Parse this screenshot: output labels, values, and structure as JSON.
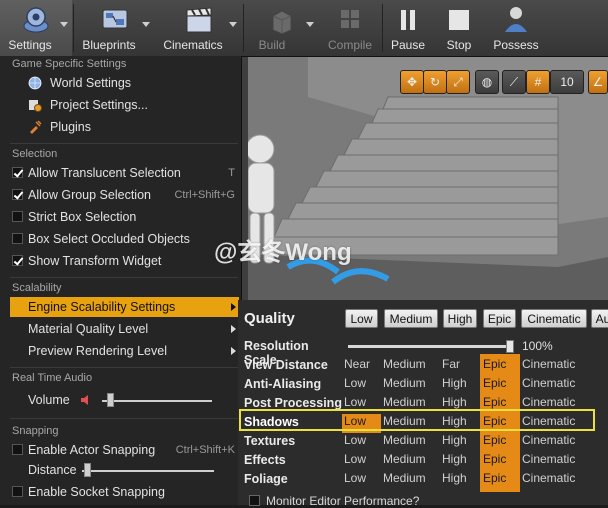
{
  "toolbar": {
    "settings": "Settings",
    "blueprints": "Blueprints",
    "cinematics": "Cinematics",
    "build": "Build",
    "compile": "Compile",
    "pause": "Pause",
    "stop": "Stop",
    "possess": "Possess"
  },
  "viewport": {
    "grid_snap_value": "10"
  },
  "menu": {
    "game_specific_header": "Game Specific Settings",
    "world_settings": "World Settings",
    "project_settings": "Project Settings...",
    "plugins": "Plugins",
    "selection_header": "Selection",
    "allow_translucent": "Allow Translucent Selection",
    "allow_translucent_shortcut": "T",
    "allow_group": "Allow Group Selection",
    "allow_group_shortcut": "Ctrl+Shift+G",
    "strict_box": "Strict Box Selection",
    "box_occluded": "Box Select Occluded Objects",
    "show_transform": "Show Transform Widget",
    "scalability_header": "Scalability",
    "engine_scalability": "Engine Scalability Settings",
    "material_quality": "Material Quality Level",
    "preview_rendering": "Preview Rendering Level",
    "realtime_audio_header": "Real Time Audio",
    "volume": "Volume",
    "snapping_header": "Snapping",
    "enable_actor_snapping": "Enable Actor Snapping",
    "enable_actor_snapping_shortcut": "Ctrl+Shift+K",
    "distance": "Distance",
    "enable_socket_snapping": "Enable Socket Snapping"
  },
  "checkboxes": {
    "allow_translucent": true,
    "allow_group": true,
    "strict_box": false,
    "box_occluded": false,
    "show_transform": true,
    "enable_actor_snapping": false,
    "enable_socket_snapping": false
  },
  "quality": {
    "title": "Quality",
    "presets": [
      "Low",
      "Medium",
      "High",
      "Epic",
      "Cinematic",
      "Au"
    ],
    "resolution_label": "Resolution Scale",
    "resolution_value": "100%",
    "rows": [
      {
        "label": "View Distance",
        "options": [
          "Near",
          "Medium",
          "Far",
          "Epic",
          "Cinematic"
        ],
        "selected": 3
      },
      {
        "label": "Anti-Aliasing",
        "options": [
          "Low",
          "Medium",
          "High",
          "Epic",
          "Cinematic"
        ],
        "selected": 3
      },
      {
        "label": "Post Processing",
        "options": [
          "Low",
          "Medium",
          "High",
          "Epic",
          "Cinematic"
        ],
        "selected": 3
      },
      {
        "label": "Shadows",
        "options": [
          "Low",
          "Medium",
          "High",
          "Epic",
          "Cinematic"
        ],
        "selected": 0
      },
      {
        "label": "Textures",
        "options": [
          "Low",
          "Medium",
          "High",
          "Epic",
          "Cinematic"
        ],
        "selected": 3
      },
      {
        "label": "Effects",
        "options": [
          "Low",
          "Medium",
          "High",
          "Epic",
          "Cinematic"
        ],
        "selected": 3
      },
      {
        "label": "Foliage",
        "options": [
          "Low",
          "Medium",
          "High",
          "Epic",
          "Cinematic"
        ],
        "selected": 3
      }
    ],
    "monitor_label": "Monitor Editor Performance?"
  },
  "watermark": "@玄冬Wong",
  "colors": {
    "accent": "#e9a20f",
    "epic_band": "#e58a17",
    "highlight_box": "#ece03a"
  }
}
